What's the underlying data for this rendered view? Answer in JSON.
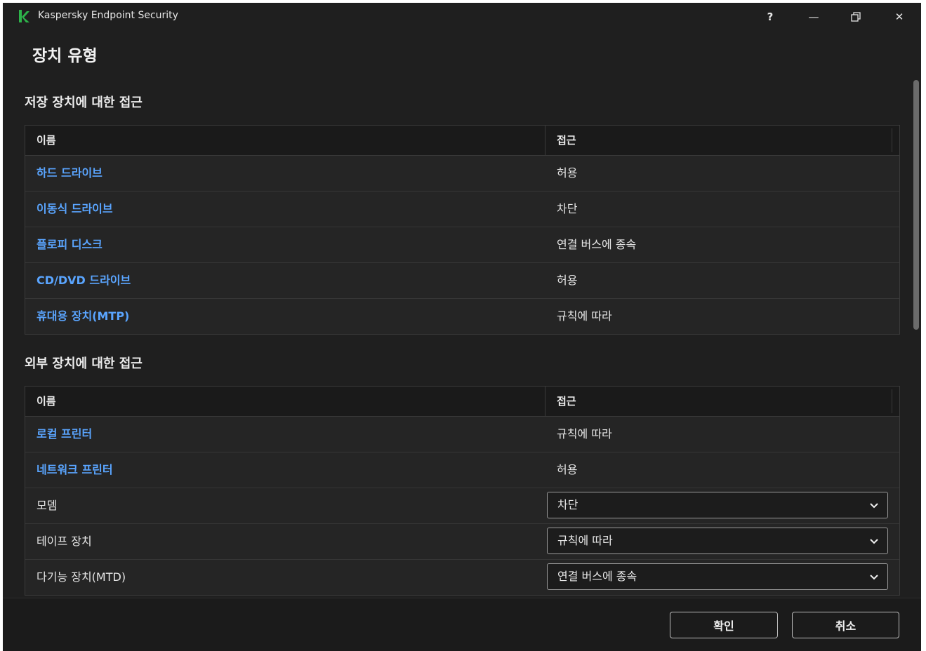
{
  "window": {
    "app_title": "Kaspersky Endpoint Security"
  },
  "titlebar_buttons": {
    "help": "?",
    "minimize": "—",
    "close": "✕"
  },
  "page": {
    "title": "장치 유형"
  },
  "storage": {
    "title": "저장 장치에 대한 접근",
    "headers": {
      "name": "이름",
      "access": "접근"
    },
    "rows": [
      {
        "name": "하드 드라이브",
        "access": "허용"
      },
      {
        "name": "이동식 드라이브",
        "access": "차단"
      },
      {
        "name": "플로피 디스크",
        "access": "연결 버스에 종속"
      },
      {
        "name": "CD/DVD 드라이브",
        "access": "허용"
      },
      {
        "name": "휴대용 장치(MTP)",
        "access": "규칙에 따라"
      }
    ]
  },
  "external": {
    "title": "외부 장치에 대한 접근",
    "headers": {
      "name": "이름",
      "access": "접근"
    },
    "link_rows": [
      {
        "name": "로컬 프린터",
        "access": "규칙에 따라"
      },
      {
        "name": "네트워크 프린터",
        "access": "허용"
      }
    ],
    "select_rows": [
      {
        "name": "모뎀",
        "access": "차단"
      },
      {
        "name": "테이프 장치",
        "access": "규칙에 따라"
      },
      {
        "name": "다기능 장치(MTD)",
        "access": "연결 버스에 종속"
      }
    ]
  },
  "footer": {
    "ok_label": "확인",
    "cancel_label": "취소"
  },
  "colors": {
    "accent_link": "#5aa5ff",
    "logo": "#2db34a",
    "background": "#1f1f1f"
  }
}
